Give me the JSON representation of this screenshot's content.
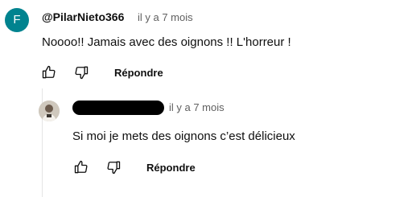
{
  "comment": {
    "avatar_letter": "F",
    "author": "@PilarNieto366",
    "time": "il y a 7 mois",
    "text": "Noooo!! Jamais avec des oignons !! L'horreur !",
    "like_icon": "thumb-up-icon",
    "dislike_icon": "thumb-down-icon",
    "reply_label": "Répondre"
  },
  "reply": {
    "author_redacted": true,
    "time": "il y a 7 mois",
    "text": "Si moi je mets des oignons c’est délicieux",
    "like_icon": "thumb-up-icon",
    "dislike_icon": "thumb-down-icon",
    "reply_label": "Répondre"
  },
  "colors": {
    "avatar_bg": "#00838f",
    "text": "#0f0f0f",
    "muted": "#606060"
  }
}
